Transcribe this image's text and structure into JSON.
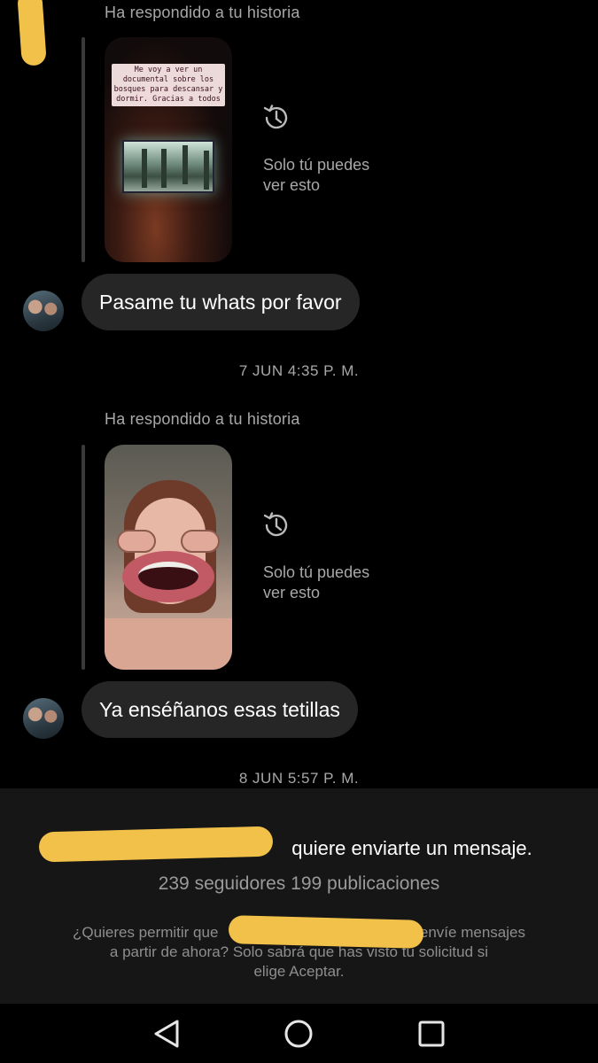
{
  "thread": {
    "messages": [
      {
        "reply_label": "Ha respondido a tu historia",
        "story_caption": "Me voy a ver un documental sobre los bosques para descansar y dormir. Gracias a todos",
        "viewed_note_line1": "Solo tú puedes",
        "viewed_note_line2": "ver esto",
        "bubble_text": "Pasame tu whats por favor"
      },
      {
        "timestamp": "7 JUN 4:35 P. M.",
        "reply_label": "Ha respondido a tu historia",
        "viewed_note_line1": "Solo tú puedes",
        "viewed_note_line2": "ver esto",
        "bubble_text": "Ya enséñanos esas tetillas"
      }
    ],
    "last_timestamp": "8 JUN 5:57 P. M."
  },
  "request": {
    "title_suffix": "quiere enviarte un mensaje.",
    "stats": "239 seguidores 199 publicaciones",
    "desc_part1": "¿Quieres permitir que",
    "desc_part2": "envíe mensajes",
    "desc_line2": "a partir de ahora? Solo sabrá que has visto tu solicitud si",
    "desc_line3": "elige Aceptar."
  },
  "colors": {
    "background": "#000000",
    "bubble": "#262626",
    "secondary_text": "#a8a8a8",
    "redaction_marker": "#f2c14a"
  },
  "icons": {
    "viewed": "clock-history-icon",
    "nav_back": "triangle-back-icon",
    "nav_home": "circle-home-icon",
    "nav_recents": "square-recents-icon"
  }
}
